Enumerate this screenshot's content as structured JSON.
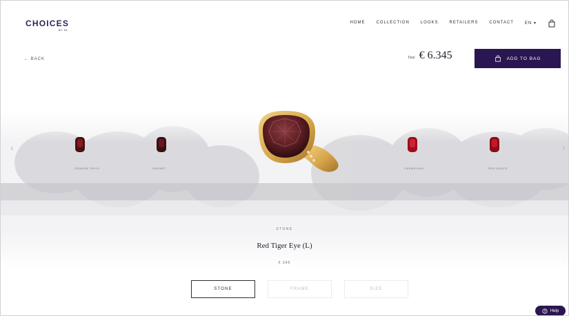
{
  "brand": {
    "name": "CHOICES",
    "sub": "BY DL"
  },
  "nav": {
    "items": [
      "HOME",
      "COLLECTION",
      "LOOKS",
      "RETAILERS",
      "CONTACT"
    ],
    "lang": "EN",
    "lang_caret": "▾"
  },
  "back": {
    "label": "← BACK"
  },
  "price": {
    "label": "Total",
    "value": "€ 6.345"
  },
  "actions": {
    "add_to_bag": "ADD TO BAG",
    "help": "Help"
  },
  "carousel": {
    "prev": "‹",
    "next": "›",
    "items": [
      {
        "label": "ORANGE ONYX"
      },
      {
        "label": "GARNET"
      },
      {
        "label": "RED TIGER EYE"
      },
      {
        "label": "CARNELIAN"
      },
      {
        "label": "RED AGATE"
      }
    ]
  },
  "selection": {
    "category": "STONE",
    "name": "Red Tiger Eye (L)",
    "price": "€ 345"
  },
  "tabs": [
    {
      "label": "STONE",
      "active": true
    },
    {
      "label": "FRAME",
      "active": false
    },
    {
      "label": "SIZE",
      "active": false
    }
  ],
  "colors": {
    "accent": "#2a1650",
    "stone": "#6b2a2e",
    "gold": "#d7a64a"
  }
}
